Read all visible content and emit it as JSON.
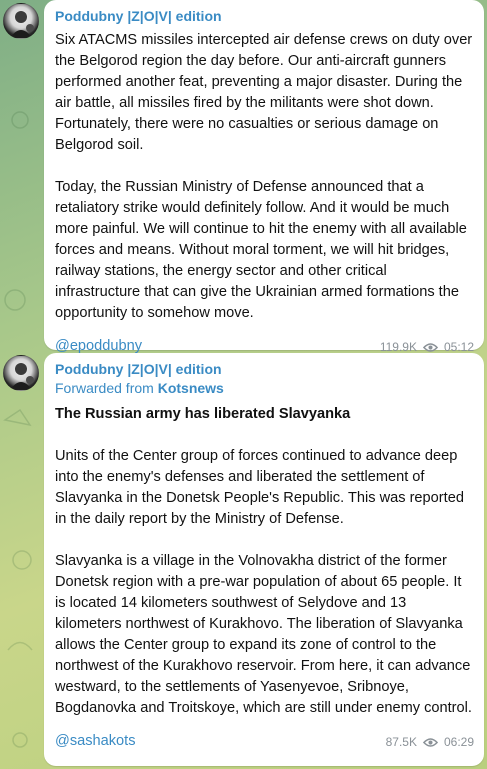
{
  "messages": [
    {
      "sender": "Poddubny |Z|O|V| edition",
      "paragraphs": [
        "Six ATACMS missiles intercepted air defense crews on duty over the Belgorod region the day before. Our anti-aircraft gunners performed another feat, preventing a major disaster. During the air battle, all missiles fired by the militants were shot down. Fortunately, there were no casualties or serious damage on Belgorod soil.",
        "Today, the Russian Ministry of Defense announced that a retaliatory strike would definitely follow. And it would be much more painful. We will continue to hit the enemy with all available forces and means. Without moral torment, we will hit bridges, railway stations, the energy sector and other critical infrastructure that can give the Ukrainian armed formations the opportunity to somehow move."
      ],
      "signature": "@epoddubny",
      "views": "119.9K",
      "time": "05:12"
    },
    {
      "sender": "Poddubny |Z|O|V| edition",
      "forwarded_prefix": "Forwarded from",
      "forwarded_source": "Kotsnews",
      "headline": "The Russian army has liberated Slavyanka",
      "paragraphs": [
        "Units of the Center group of forces continued to advance deep into the enemy's defenses and liberated the settlement of Slavyanka in the Donetsk People's Republic. This was reported in the daily report by the Ministry of Defense.",
        "Slavyanka is a village in the Volnovakha district of the former Donetsk region with a pre-war population of about 65 people. It is located 14 kilometers southwest of Selydove and 13 kilometers northwest of Kurakhovo. The liberation of Slavyanka allows the Center group to expand its zone of control to the northwest of the Kurakhovo reservoir. From here, it can advance westward, to the settlements of Yasenyevoe, Sribnoye, Bogdanovka and Troitskoye, which are still under enemy control."
      ],
      "signature": "@sashakots",
      "views": "87.5K",
      "time": "06:29"
    }
  ],
  "icons": {
    "views": "eye-icon",
    "avatar": "channel-avatar"
  },
  "colors": {
    "accent": "#3a8bc4",
    "meta": "#8a9197",
    "bubble": "#ffffff"
  }
}
